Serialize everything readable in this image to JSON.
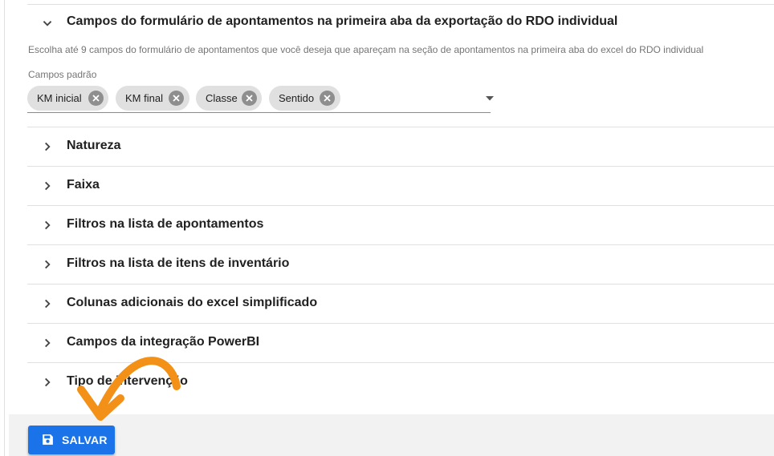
{
  "expanded_panel": {
    "title": "Campos do formulário de apontamentos na primeira aba da exportação do RDO individual",
    "help_text": "Escolha até 9 campos do formulário de apontamentos que você deseja que apareçam na seção de apontamentos na primeira aba do excel do RDO individual",
    "field_label": "Campos padrão",
    "chips": [
      "KM inicial",
      "KM final",
      "Classe",
      "Sentido"
    ]
  },
  "panels": [
    {
      "title": "Natureza"
    },
    {
      "title": "Faixa"
    },
    {
      "title": "Filtros na lista de apontamentos"
    },
    {
      "title": "Filtros na lista de itens de inventário"
    },
    {
      "title": "Colunas adicionais do excel simplificado"
    },
    {
      "title": "Campos da integração PowerBI"
    },
    {
      "title": "Tipo de intervenção"
    }
  ],
  "footer": {
    "save_label": "SALVAR"
  },
  "icons": {
    "expanded": "chevron-down-icon",
    "collapsed": "chevron-right-icon",
    "chip_remove": "close-circle-icon",
    "dropdown": "arrow-drop-down-icon",
    "save": "floppy-disk-icon",
    "annotation": "curved-arrow-icon"
  },
  "colors": {
    "primary_button": "#1a73e8",
    "annotation_arrow": "#f39018",
    "chip_background": "#e0e0e0"
  }
}
